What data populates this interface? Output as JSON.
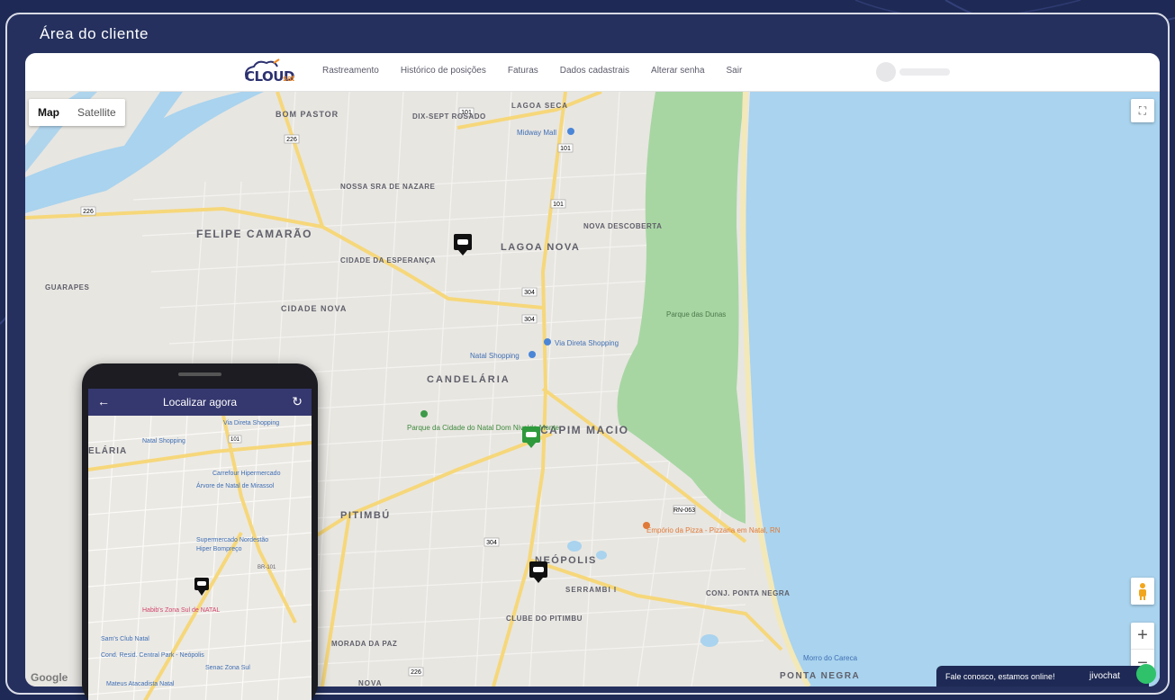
{
  "frame": {
    "title": "Área do cliente"
  },
  "brand": {
    "logo_text": "CLOUD",
    "logo_sub": "sat"
  },
  "nav": {
    "items": [
      {
        "label": "Rastreamento"
      },
      {
        "label": "Histórico de posições"
      },
      {
        "label": "Faturas"
      },
      {
        "label": "Dados cadastrais"
      },
      {
        "label": "Alterar senha"
      },
      {
        "label": "Sair"
      }
    ]
  },
  "map": {
    "type_controls": {
      "map": "Map",
      "satellite": "Satellite",
      "active": "map"
    },
    "attribution": "Google",
    "labels": {
      "bom_pastor": "BOM PASTOR",
      "dix_sept_rosado": "DIX-SEPT ROSADO",
      "lagoa_seca": "LAGOA SECA",
      "midway_mall": "Midway Mall",
      "nossa_sra_de_nazare": "NOSSA SRA DE NAZARE",
      "felipe_camarao": "FELIPE CAMARÃO",
      "lagoa_nova": "LAGOA NOVA",
      "nova_descoberta": "NOVA DESCOBERTA",
      "cidade_da_esperanca": "CIDADE DA ESPERANÇA",
      "guarapes": "GUARAPES",
      "cidade_nova": "CIDADE NOVA",
      "parque_das_dunas": "Parque das Dunas",
      "via_direta_shopping": "Via Direta Shopping",
      "natal_shopping": "Natal Shopping",
      "candelaria": "CANDELÁRIA",
      "parque_cidade_natal": "Parque da Cidade do Natal Dom Nivaldo Monte",
      "capim_macio": "CAPIM MACIO",
      "pitimbu": "PITIMBÚ",
      "emporio_da_pizza": "Empório da Pizza - Pizzaria em Natal, RN",
      "neopolis": "NEÓPOLIS",
      "serrambi": "SERRAMBI I",
      "conj_ponta_negra": "CONJ. PONTA NEGRA",
      "clube_do_pitimbu": "CLUBE DO PITIMBU",
      "morada_da_paz": "MORADA DA PAZ",
      "morro_do_careca": "Morro do Careca",
      "ponta_negra": "PONTA NEGRA",
      "nova": "NOVA"
    },
    "route_shields": [
      "101",
      "226",
      "226",
      "101",
      "101",
      "304",
      "304",
      "304",
      "226",
      "RN-063"
    ]
  },
  "chat": {
    "text": "Fale conosco, estamos online!",
    "brand": "jivochat"
  },
  "phone": {
    "title": "Localizar agora",
    "labels": {
      "via_direta": "Via Direta Shopping",
      "natal_shopping": "Natal Shopping",
      "elaria": "ELÁRIA",
      "carrefour": "Carrefour Hipermercado",
      "arvore": "Árvore de Natal de Mirassol",
      "supermercado": "Supermercado Nordestão",
      "hiper": "Hiper Bompreço",
      "habibs": "Habib's Zona Sul de NATAL",
      "sams": "Sam's Club Natal",
      "cond": "Cond. Resid. Central Park - Neópolis",
      "senac": "Senac Zona Sul",
      "mateus": "Mateus Atacadista Natal",
      "br101": "BR-101",
      "shield": "101"
    },
    "colors": {
      "appbar": "#35376f"
    }
  },
  "colors": {
    "frame_bg": "#25305e",
    "page_bg": "#1e2a55",
    "sea": "#a9d3ee",
    "park": "#a7d6a3",
    "land": "#e8e6e1",
    "marker_active": "#2e9a3c",
    "marker": "#111111"
  }
}
